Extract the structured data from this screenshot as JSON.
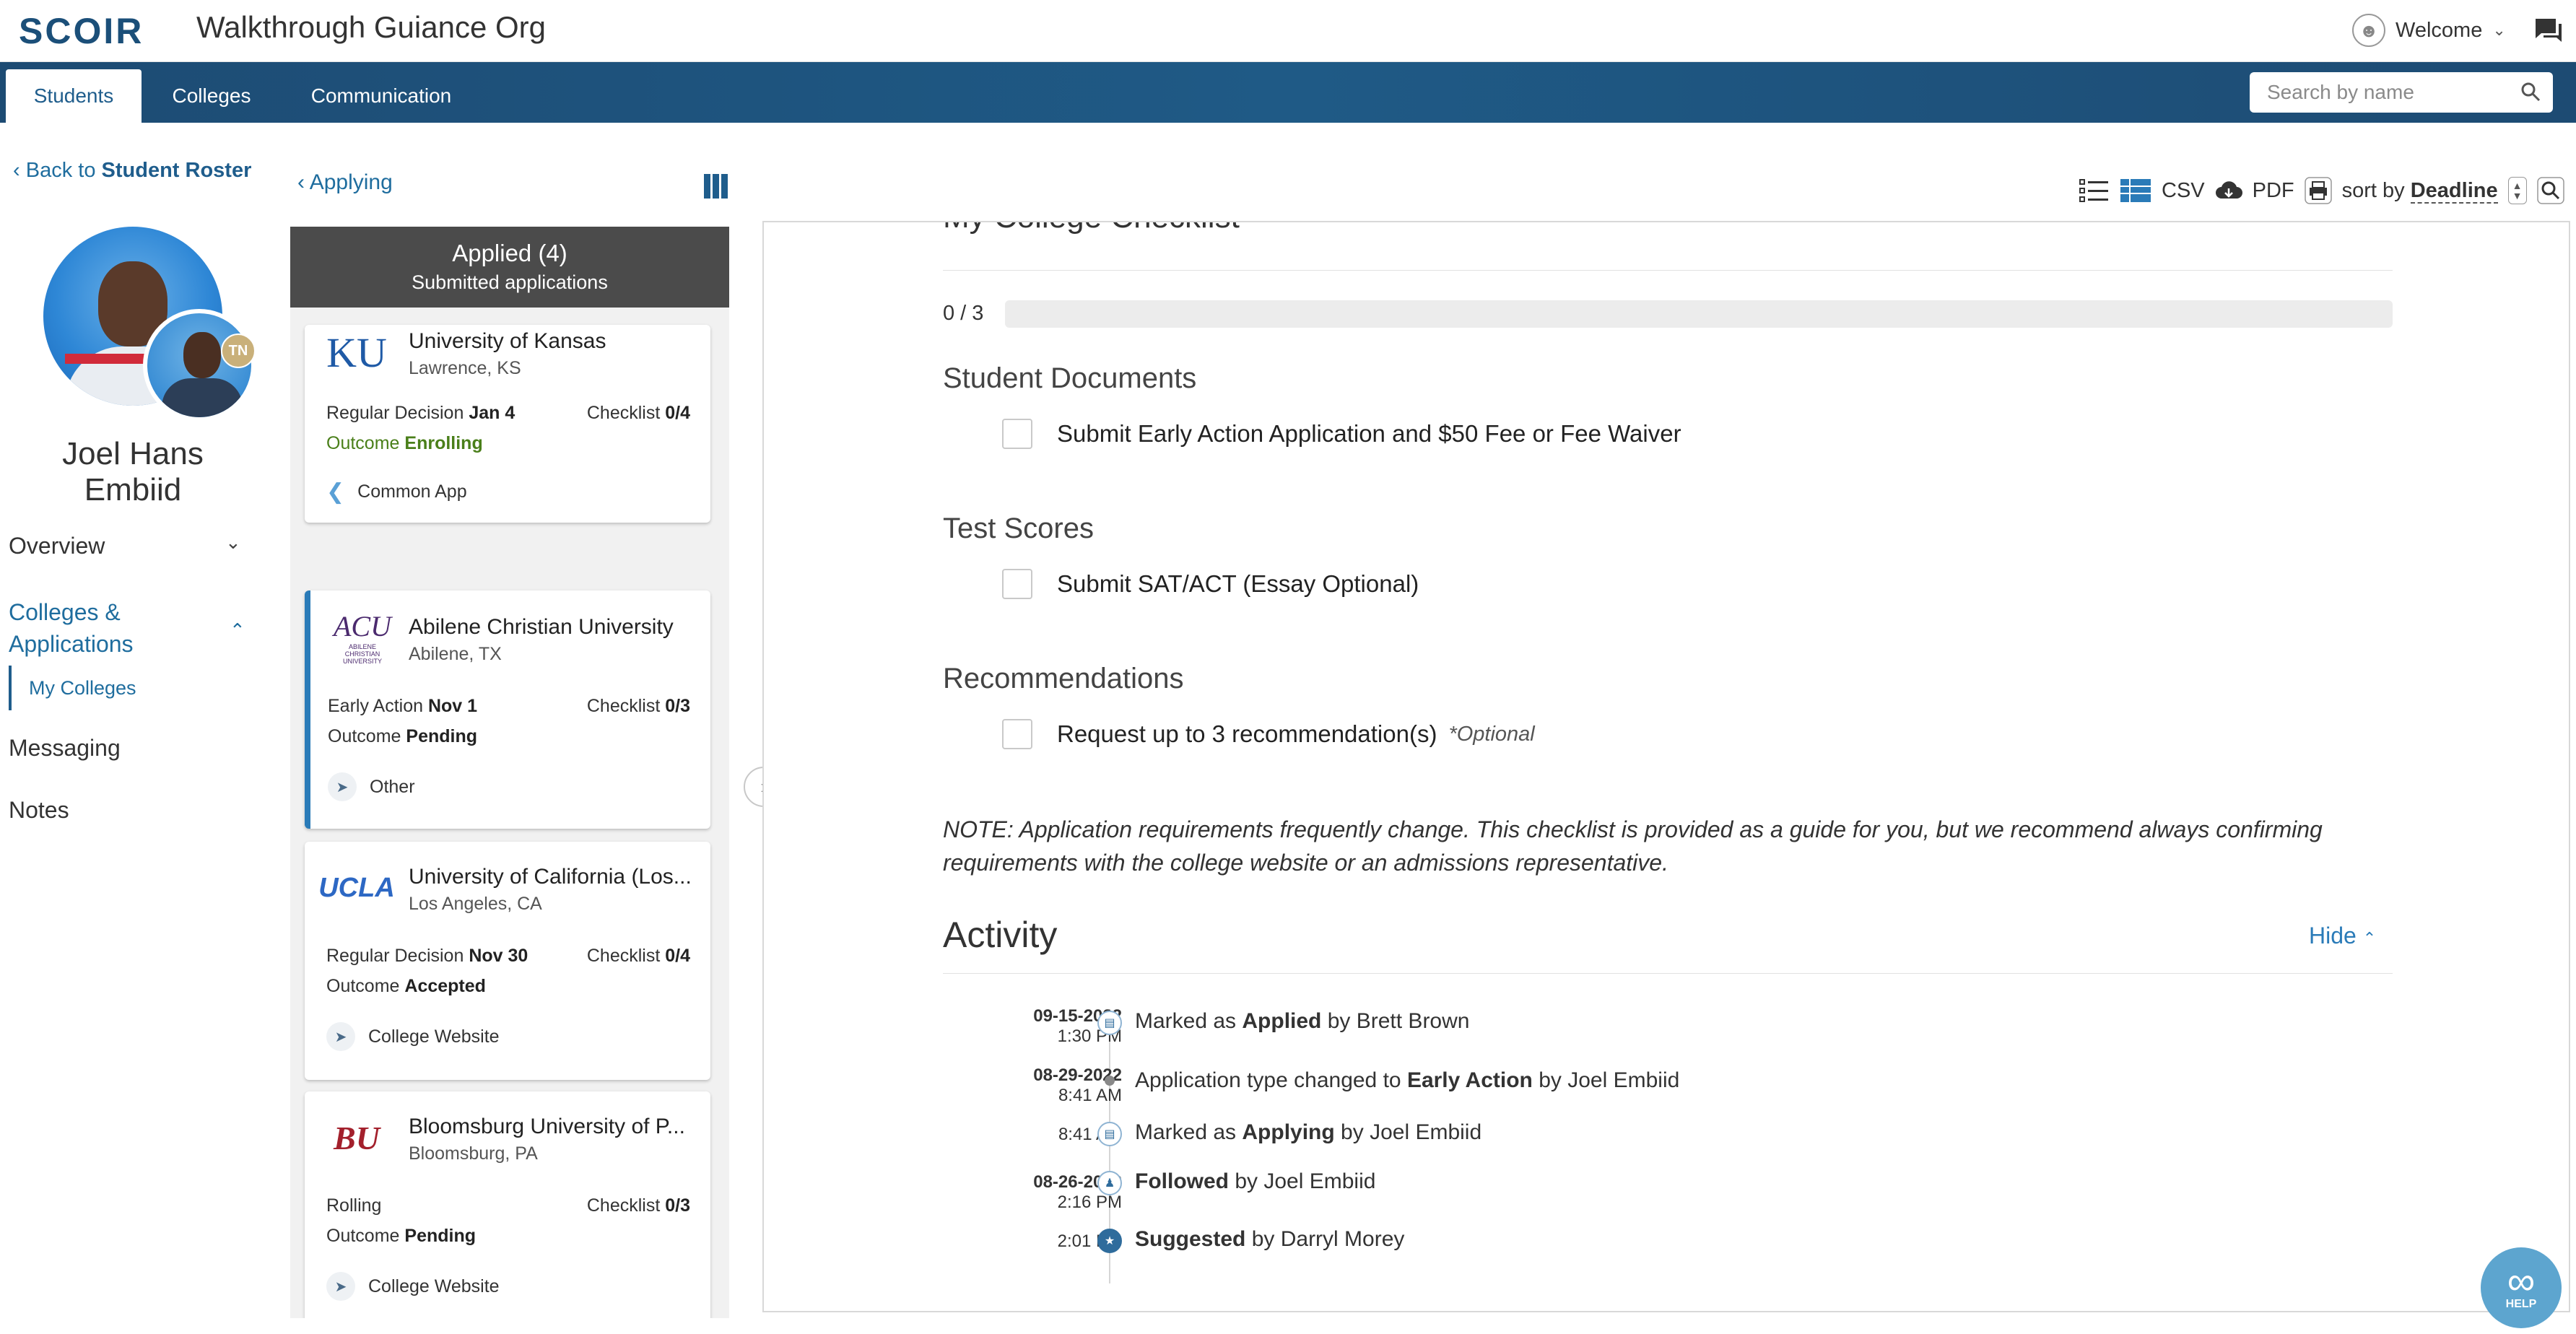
{
  "app": {
    "logo": "SCOIR",
    "org_title": "Walkthrough Guiance Org",
    "welcome": "Welcome"
  },
  "nav": {
    "tabs": [
      "Students",
      "Colleges",
      "Communication"
    ],
    "active_tab": "Students",
    "search_placeholder": "Search by name"
  },
  "sidebar": {
    "back_prefix": "Back to ",
    "back_target": "Student Roster",
    "student_name": "Joel Hans Embiid",
    "badge": "TN",
    "items": {
      "overview": "Overview",
      "colleges_apps": "Colleges & Applications",
      "my_colleges": "My Colleges",
      "messaging": "Messaging",
      "notes": "Notes"
    }
  },
  "middle": {
    "back_label": "Applying",
    "header_title": "Applied (4)",
    "header_subtitle": "Submitted applications",
    "cards": [
      {
        "logo_text": "KU",
        "name": "University of Kansas",
        "city": "Lawrence, KS",
        "type": "Regular Decision",
        "date": "Jan 4",
        "checklist_label": "Checklist",
        "checklist": "0/4",
        "outcome_label": "Outcome",
        "outcome": "Enrolling",
        "method": "Common App"
      },
      {
        "logo_text": "ACU",
        "logo_sub": "ABILENE CHRISTIAN UNIVERSITY",
        "name": "Abilene Christian University",
        "city": "Abilene, TX",
        "type": "Early Action",
        "date": "Nov 1",
        "checklist_label": "Checklist",
        "checklist": "0/3",
        "outcome_label": "Outcome",
        "outcome": "Pending",
        "method": "Other"
      },
      {
        "logo_text": "UCLA",
        "name": "University of California (Los...",
        "city": "Los Angeles, CA",
        "type": "Regular Decision",
        "date": "Nov 30",
        "checklist_label": "Checklist",
        "checklist": "0/4",
        "outcome_label": "Outcome",
        "outcome": "Accepted",
        "method": "College Website"
      },
      {
        "logo_text": "BU",
        "name": "Bloomsburg University of P...",
        "city": "Bloomsburg, PA",
        "type": "Rolling",
        "date": "",
        "checklist_label": "Checklist",
        "checklist": "0/3",
        "outcome_label": "Outcome",
        "outcome": "Pending",
        "method": "College Website"
      }
    ]
  },
  "toolbar": {
    "csv": "CSV",
    "pdf": "PDF",
    "sort_prefix": "sort by",
    "sort_value": "Deadline"
  },
  "checklist": {
    "title": "My College Checklist",
    "progress_text": "0 / 3",
    "progress_fraction": 0,
    "sections": [
      {
        "title": "Student Documents",
        "items": [
          {
            "label": "Submit Early Action Application and $50 Fee or Fee Waiver",
            "optional": ""
          }
        ]
      },
      {
        "title": "Test Scores",
        "items": [
          {
            "label": "Submit SAT/ACT (Essay Optional)",
            "optional": ""
          }
        ]
      },
      {
        "title": "Recommendations",
        "items": [
          {
            "label": "Request up to 3 recommendation(s)",
            "optional": "*Optional"
          }
        ]
      }
    ],
    "note": "NOTE: Application requirements frequently change. This checklist is provided as a guide for you, but we recommend always confirming requirements with the college website or an admissions representative."
  },
  "activity": {
    "title": "Activity",
    "hide_label": "Hide",
    "entries": [
      {
        "date": "09-15-2022",
        "time": "1:30 PM",
        "pre": "Marked as ",
        "strong": "Applied",
        "post": " by Brett Brown",
        "icon": "document-icon"
      },
      {
        "date": "08-29-2022",
        "time": "8:41 AM",
        "pre": "Application type changed to ",
        "strong": "Early Action",
        "post": " by Joel Embiid",
        "icon": "dot"
      },
      {
        "date": "",
        "time": "8:41 AM",
        "pre": "Marked as ",
        "strong": "Applying",
        "post": " by Joel Embiid",
        "icon": "document-icon"
      },
      {
        "date": "08-26-2022",
        "time": "2:16 PM",
        "pre": "",
        "strong": "Followed",
        "post": " by Joel Embiid",
        "icon": "follow-icon"
      },
      {
        "date": "",
        "time": "2:01 PM",
        "pre": "",
        "strong": "Suggested",
        "post": " by Darryl Morey",
        "icon": "suggest-icon"
      }
    ]
  },
  "help": {
    "label": "HELP"
  },
  "colors": {
    "brand": "#1d4b73",
    "link": "#1f6d9e",
    "enrolling": "#4a7f1a",
    "accent": "#2a7bb8"
  }
}
